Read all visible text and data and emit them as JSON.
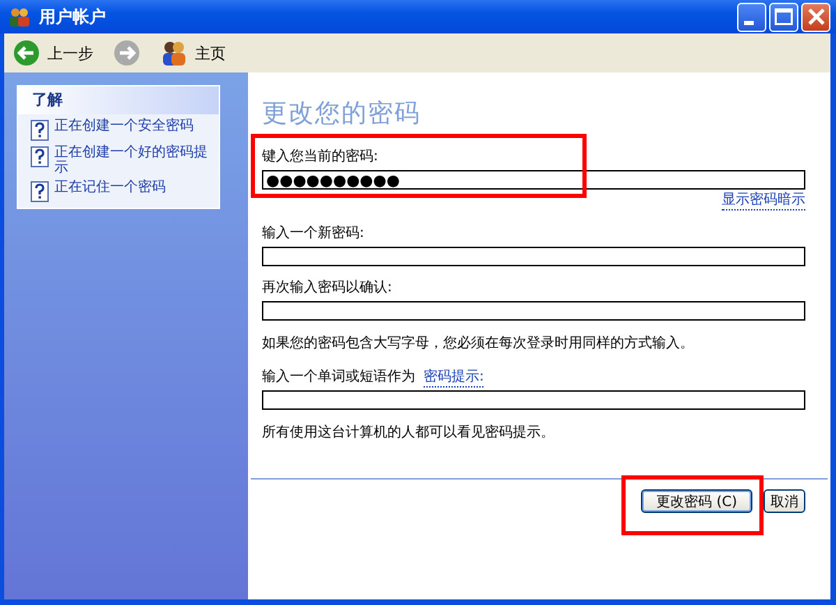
{
  "window": {
    "title": "用户帐户"
  },
  "toolbar": [
    {
      "kind": "back",
      "label": "上一步",
      "disabled": false
    },
    {
      "kind": "forward",
      "disabled": true
    },
    {
      "kind": "home",
      "label": "主页"
    }
  ],
  "sidebar": {
    "title": "了解",
    "items": [
      "正在创建一个安全密码",
      "正在创建一个好的密码提示",
      "正在记住一个密码"
    ]
  },
  "form": {
    "title": "更改您的密码",
    "rows": [
      {
        "kind": "field",
        "label": "键入您当前的密码:",
        "value": "●●●●●●●●●●"
      },
      {
        "kind": "link",
        "text": "显示密码暗示"
      },
      {
        "kind": "field",
        "label": "输入一个新密码:"
      },
      {
        "kind": "field",
        "label": "再次输入密码以确认:"
      },
      {
        "kind": "note",
        "text": "如果您的密码包含大写字母，您必须在每次登录时用同样的方式输入。"
      },
      {
        "kind": "hint_field",
        "label": "输入一个单词或短语作为",
        "link": "密码提示:"
      },
      {
        "kind": "note",
        "text": "所有使用这台计算机的人都可以看见密码提示。"
      }
    ]
  },
  "buttons": [
    {
      "label": "更改密码 (C)",
      "default": true
    },
    {
      "label": "取消",
      "default": false
    }
  ]
}
